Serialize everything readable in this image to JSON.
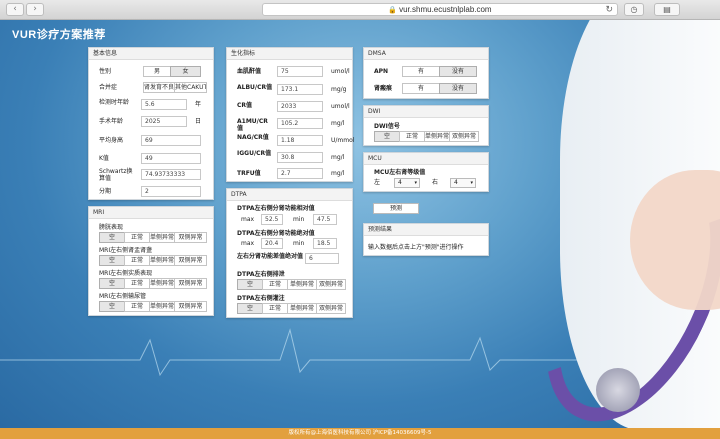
{
  "browser": {
    "url": "vur.shmu.ecustnlplab.com",
    "back_icon": "chevron-left-icon",
    "forward_icon": "chevron-right-icon"
  },
  "app_title": "VUR诊疗方案推荐",
  "basic": {
    "header": "基本信息",
    "sex_label": "性别",
    "sex_options": [
      "男",
      "女"
    ],
    "sex_selected": "女",
    "comorbid_label": "合并症",
    "comorbid_options": [
      "肾发育不良",
      "其他CAKUT"
    ],
    "age_label": "检测时年龄",
    "age_value": "5.6",
    "age_unit": "年",
    "surgery_year_label": "手术年龄",
    "surgery_year_value": "2025",
    "surgery_year_unit": "日",
    "height_label": "平均身高",
    "height_value": "69",
    "k_label": "K值",
    "k_value": "49",
    "schwartz_label": "Schwartz换算值",
    "schwartz_value": "74.93733333",
    "stage_label": "分期",
    "stage_value": "2"
  },
  "bio": {
    "header": "生化指标",
    "rows": [
      {
        "label": "血肌酐值",
        "value": "75",
        "unit": "umol/l"
      },
      {
        "label": "ALBU/CR值",
        "value": "173.1",
        "unit": "mg/g"
      },
      {
        "label": "CR值",
        "value": "2033",
        "unit": "umol/l"
      },
      {
        "label": "A1MU/CR值",
        "value": "105.2",
        "unit": "mg/l"
      },
      {
        "label": "NAG/CR值",
        "value": "1.18",
        "unit": "U/mmol"
      },
      {
        "label": "IGGU/CR值",
        "value": "30.8",
        "unit": "mg/l"
      },
      {
        "label": "TRFU值",
        "value": "2.7",
        "unit": "mg/l"
      }
    ]
  },
  "dmsa": {
    "header": "DMSA",
    "apn_label": "APN",
    "apn_options": [
      "有",
      "没有"
    ],
    "apn_selected": "没有",
    "scar_label": "肾瘢痕",
    "scar_options": [
      "有",
      "没有"
    ],
    "scar_selected": "没有"
  },
  "dwi": {
    "header": "DWI",
    "signal_label": "DWI信号",
    "options": [
      "空",
      "正常",
      "单侧异常",
      "双侧异常"
    ],
    "selected": "空"
  },
  "mcu": {
    "header": "MCU",
    "grade_label": "MCU左右肾等级值",
    "left_label": "左",
    "left_value": "4",
    "right_label": "右",
    "right_value": "4"
  },
  "predict_button": "预测",
  "result": {
    "header": "预测结果",
    "text": "输入数据后点击上方\"预测\"进行操作"
  },
  "mri": {
    "header": "MRI",
    "rows": [
      {
        "label": "膀胱表现",
        "selected": "空"
      },
      {
        "label": "MRI左右侧肾盂肾盏",
        "selected": "空"
      },
      {
        "label": "MRI左右侧实质表现",
        "selected": "空"
      },
      {
        "label": "MRI左右侧输尿管",
        "selected": "空"
      }
    ],
    "options": [
      "空",
      "正常",
      "单侧异常",
      "双侧异常"
    ]
  },
  "dtpa": {
    "header": "DTPA",
    "func_label": "DTPA左右侧分肾功能相对值",
    "func_max_label": "max",
    "func_max": "52.5",
    "func_min_label": "min",
    "func_min": "47.5",
    "abs_label": "DTPA左右侧分肾功能绝对值",
    "abs_max_label": "max",
    "abs_max": "20.4",
    "abs_min_label": "min",
    "abs_min": "18.5",
    "diff_label": "左右分肾功能差值绝对值",
    "diff_value": "6",
    "drain_label": "DTPA左右侧排泄",
    "fill_label": "DTPA左右侧灌注",
    "options": [
      "空",
      "正常",
      "单侧异常",
      "双侧异常"
    ],
    "drain_selected": "空",
    "fill_selected": "空"
  },
  "footer": "版权所有@上海佰医科技有限公司 沪ICP备14036609号-5",
  "colors": {
    "footer_bg": "#e2a03e",
    "background": "#5fa0cc"
  }
}
